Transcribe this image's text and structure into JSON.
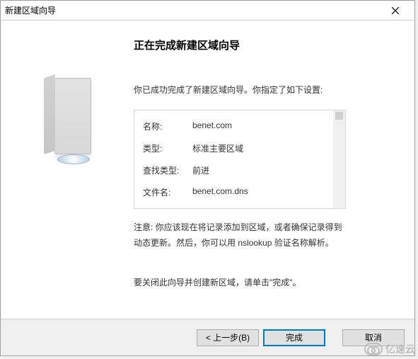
{
  "window": {
    "title": "新建区域向导"
  },
  "content": {
    "heading": "正在完成新建区域向导",
    "intro": "你已成功完成了新建区域向导。你指定了如下设置:",
    "settings": {
      "name_label": "名称:",
      "name_value": "benet.com",
      "type_label": "类型:",
      "type_value": "标准主要区域",
      "lookup_label": "查找类型:",
      "lookup_value": "前进",
      "file_label": "文件名:",
      "file_value": "benet.com.dns"
    },
    "notice": "注意: 你应该现在将记录添加到区域，或者确保记录得到动态更新。然后，你可以用 nslookup 验证名称解析。",
    "final_instruction": "要关闭此向导并创建新区域，请单击\"完成\"。"
  },
  "footer": {
    "back": "< 上一步(B)",
    "finish": "完成",
    "cancel": "取消"
  },
  "watermark": "亿速云"
}
